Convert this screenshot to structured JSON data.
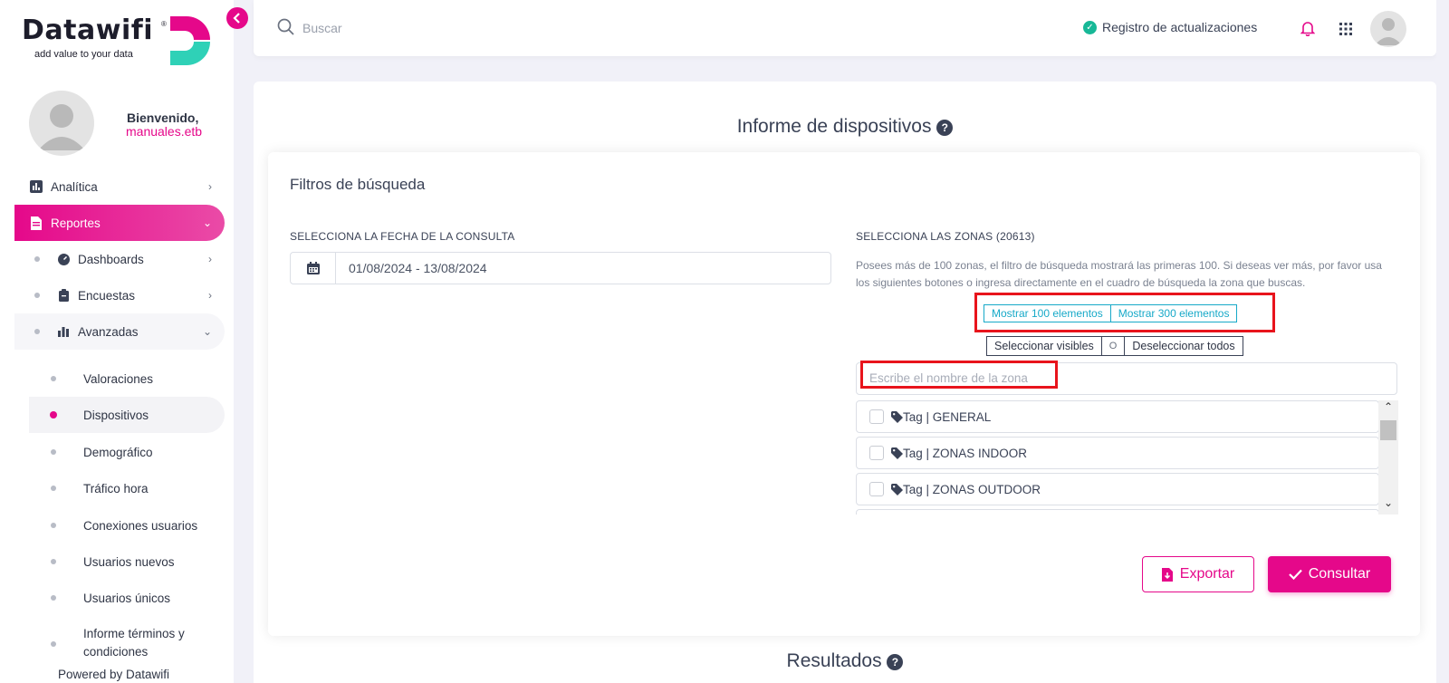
{
  "brand": {
    "name": "Datawifi",
    "reg": "®",
    "tagline": "add value to your data",
    "pink": "#e5088a",
    "teal": "#2fd1b7"
  },
  "profile": {
    "welcome": "Bienvenido,",
    "username": "manuales.etb"
  },
  "sidebar": {
    "items": [
      {
        "label": "Analítica",
        "icon": "bar-chart-icon"
      },
      {
        "label": "Reportes",
        "icon": "document-icon",
        "active": true
      },
      {
        "label": "Dashboards",
        "icon": "dashboard-icon"
      },
      {
        "label": "Encuestas",
        "icon": "clipboard-icon"
      },
      {
        "label": "Avanzadas",
        "icon": "bars-icon"
      }
    ],
    "subitems": [
      "Valoraciones",
      "Dispositivos",
      "Demográfico",
      "Tráfico hora",
      "Conexiones usuarios",
      "Usuarios nuevos",
      "Usuarios únicos",
      "Informe términos y condiciones"
    ],
    "selected": "Dispositivos",
    "powered": "Powered by Datawifi"
  },
  "topbar": {
    "search_placeholder": "Buscar",
    "updates": "Registro de actualizaciones"
  },
  "page": {
    "title": "Informe de dispositivos",
    "results": "Resultados"
  },
  "filters": {
    "title": "Filtros de búsqueda",
    "date_label": "SELECCIONA LA FECHA DE LA CONSULTA",
    "date_value": "01/08/2024 - 13/08/2024",
    "zones_label": "SELECCIONA LAS ZONAS (20613)",
    "zones_info": "Posees más de 100 zonas, el filtro de búsqueda mostrará las primeras 100. Si deseas ver más, por favor usa los siguientes botones o ingresa directamente en el cuadro de búsqueda la zona que buscas.",
    "show_100": "Mostrar 100 elementos",
    "show_300": "Mostrar 300 elementos",
    "select_visible": "Seleccionar visibles",
    "or": "O",
    "deselect_all": "Deseleccionar todos",
    "zone_placeholder": "Escribe el nombre de la zona",
    "zones": [
      "Tag | GENERAL",
      "Tag | ZONAS INDOOR",
      "Tag | ZONAS OUTDOOR"
    ],
    "export": "Exportar",
    "consult": "Consultar"
  }
}
